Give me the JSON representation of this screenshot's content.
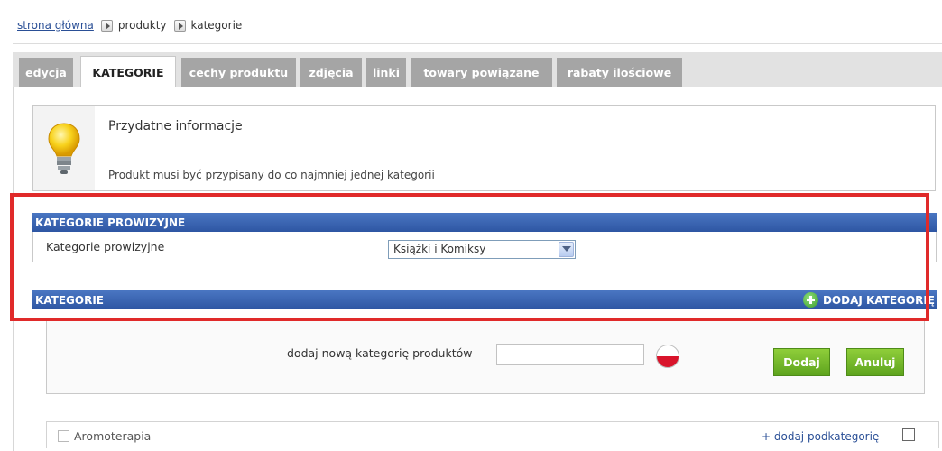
{
  "breadcrumb": {
    "home": "strona główna",
    "products": "produkty",
    "categories": "kategorie"
  },
  "tabs": [
    {
      "label": "edycja",
      "active": false
    },
    {
      "label": "KATEGORIE",
      "active": true
    },
    {
      "label": "cechy produktu",
      "active": false
    },
    {
      "label": "zdjęcia",
      "active": false
    },
    {
      "label": "linki",
      "active": false
    },
    {
      "label": "towary powiązane",
      "active": false
    },
    {
      "label": "rabaty ilościowe",
      "active": false
    }
  ],
  "info": {
    "icon": "lightbulb-icon",
    "title": "Przydatne informacje",
    "text": "Produkt musi być przypisany do co najmniej jednej kategorii"
  },
  "commission": {
    "header": "KATEGORIE PROWIZYJNE",
    "label": "Kategorie prowizyjne",
    "selected": "Książki i Komiksy"
  },
  "categories": {
    "header": "KATEGORIE",
    "add_link": "DODAJ KATEGORIĘ",
    "new_label": "dodaj nową kategorię produktów",
    "input_value": "",
    "add_button": "Dodaj",
    "cancel_button": "Anuluj",
    "items": [
      {
        "label": "Aromoterapia",
        "add_sub": "+ dodaj podkategorię"
      }
    ]
  },
  "colors": {
    "header_blue": "#2e56a3",
    "button_green": "#6db326",
    "highlight_red": "#e02a2a",
    "tab_gray": "#a5a5a5"
  }
}
